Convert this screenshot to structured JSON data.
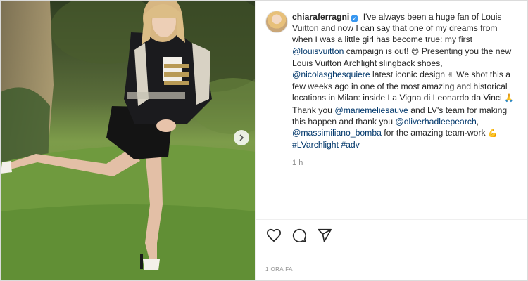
{
  "post": {
    "username": "chiaraferragni",
    "verified": true,
    "caption": {
      "intro": "I've always been a huge fan of Louis Vuitton and now I can say that one of my dreams from when I was a little girl has become true: my first",
      "mention1": "@louisvuitton",
      "part2": "campaign is out!",
      "emoji1": "😊",
      "part3": "Presenting you the new Louis Vuitton Archlight slingback shoes,",
      "mention2": "@nicolasghesquiere",
      "part4": "latest iconic design",
      "emoji2": "✌",
      "part5": "We shot this a few weeks ago in one of the most amazing and historical locations in Milan: inside La Vigna di Leonardo da Vinci",
      "emoji3": "🙏",
      "part6": "Thank you",
      "mention3": "@mariemeliesauve",
      "part7": "and LV's team for making this happen and thank you",
      "mention4": "@oliverhadleepearch",
      "comma": ",",
      "mention5": "@massimiliano_bomba",
      "part8": "for the amazing team-work",
      "emoji4": "💪",
      "hashtag1": "#LVarchlight",
      "hashtag2": "#adv"
    },
    "time_ago": "1 h",
    "posted_date": "1 ORA FA"
  },
  "icons": {
    "like": "heart-icon",
    "comment": "comment-icon",
    "share": "paper-plane-icon",
    "next": "chevron-right-icon"
  },
  "colors": {
    "link": "#00376b",
    "muted": "#8e8e8e",
    "verified": "#3897f0",
    "text": "#262626"
  }
}
